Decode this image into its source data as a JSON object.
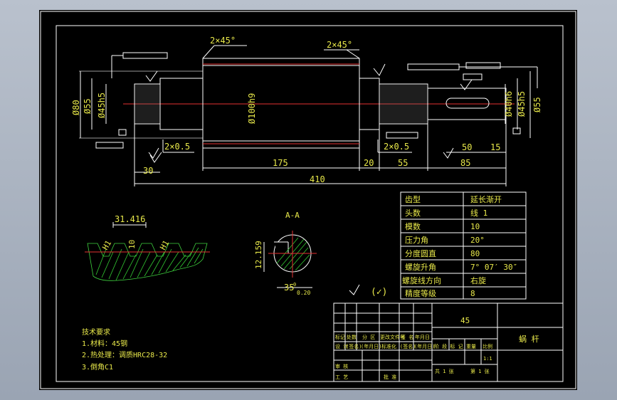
{
  "dimensions": {
    "chamfer_left": "2×45°",
    "chamfer_right": "2×45°",
    "dia_80": "Ø80",
    "dia_55_left": "Ø55",
    "dia_45h5_left": "Ø45h5",
    "dia_100h9": "Ø100h9",
    "dia_40h6": "Ø40h6",
    "dia_45h5_right": "Ø45h5",
    "dia_55_right": "Ø55",
    "groove_left": "2×0.5",
    "groove_right": "2×0.5",
    "len_30": "30",
    "len_175": "175",
    "len_20": "20",
    "len_55": "55",
    "len_85": "85",
    "len_410": "410",
    "len_50": "50",
    "len_15": "15",
    "tooth_31416": "31.416",
    "tooth_h1_a": "H1",
    "tooth_10": "10",
    "tooth_h1_b": "H1",
    "section_title": "A-A",
    "section_12159": "12.159",
    "section_35": "35",
    "section_tol": "0.20",
    "section_sup": "0",
    "rough_mark": "(✓)"
  },
  "params_table": {
    "rows": [
      {
        "label": "齿型",
        "value": "延长渐开"
      },
      {
        "label": "头数",
        "value": "线 1"
      },
      {
        "label": "模数",
        "value": "10"
      },
      {
        "label": "压力角",
        "value": "20°"
      },
      {
        "label": "分度圆直",
        "value": "80"
      },
      {
        "label": "螺旋升角",
        "value": "7° 07′ 30″"
      },
      {
        "label": "螺旋线方向",
        "value": "右旋"
      },
      {
        "label": "精度等级",
        "value": "8"
      }
    ]
  },
  "tech_req": {
    "title": "技术要求",
    "items": [
      "1.材料：45钢",
      "2.热处理：调质HRC28-32",
      "3.倒角C1"
    ]
  },
  "title_block": {
    "material": "45",
    "part_name": "蜗  杆",
    "scale": "1:1",
    "sheets_total": "共 1 张",
    "sheet_no": "第 1 张",
    "labels": {
      "mark": "标记",
      "count": "处数",
      "zone": "分 区",
      "doc": "更改文件号",
      "sign": "签 名",
      "date": "年月日",
      "design": "设 计",
      "standard": "标准化",
      "stage": "阶 段 标 记",
      "weight": "重量",
      "ratio": "比例",
      "review": "审 核",
      "process": "工 艺",
      "approve": "批 准",
      "sig_a": "(签名)",
      "date_a": "(年月日)",
      "sig_b": "(签名)",
      "date_b": "(年月日)"
    }
  }
}
